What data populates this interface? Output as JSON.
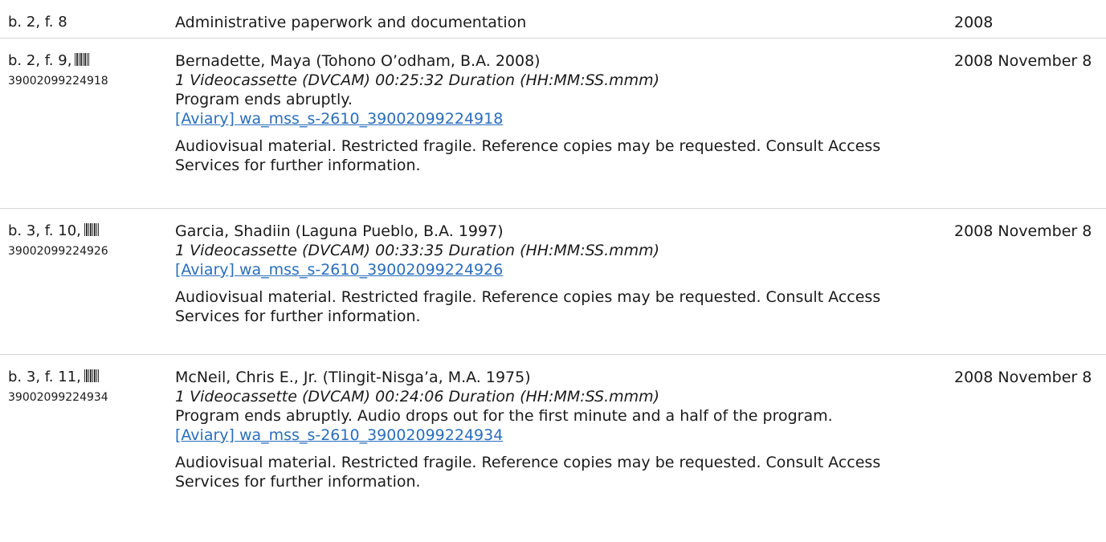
{
  "rows": [
    {
      "container": "b. 2, f. 8",
      "title": "Administrative paperwork and documentation",
      "date": "2008"
    },
    {
      "container": "b. 2, f. 9,",
      "barcode": "39002099224918",
      "title": "Bernadette, Maya (Tohono O’odham, B.A. 2008)",
      "extent": "1 Videocassette (DVCAM)  00:25:32 Duration (HH:MM:SS.mmm)",
      "note": "Program ends abruptly.",
      "link": "[Aviary] wa_mss_s-2610_39002099224918",
      "access": "Audiovisual material. Restricted fragile. Reference copies may be requested. Consult Access Services for further information.",
      "date": "2008 November 8"
    },
    {
      "container": "b. 3, f. 10,",
      "barcode": "39002099224926",
      "title": "Garcia, Shadiin (Laguna Pueblo, B.A. 1997)",
      "extent": "1 Videocassette (DVCAM)  00:33:35 Duration (HH:MM:SS.mmm)",
      "link": "[Aviary] wa_mss_s-2610_39002099224926",
      "access": "Audiovisual material. Restricted fragile. Reference copies may be requested. Consult Access Services for further information.",
      "date": "2008 November 8"
    },
    {
      "container": "b. 3, f. 11,",
      "barcode": "39002099224934",
      "title": "McNeil, Chris E., Jr. (Tlingit-Nisga’a, M.A. 1975)",
      "extent": "1 Videocassette (DVCAM)  00:24:06 Duration (HH:MM:SS.mmm)",
      "note": "Program ends abruptly. Audio drops out for the first minute and a half of the program.",
      "link": "[Aviary] wa_mss_s-2610_39002099224934",
      "access": "Audiovisual material. Restricted fragile. Reference copies may be requested. Consult Access Services for further information.",
      "date": "2008 November 8"
    }
  ]
}
